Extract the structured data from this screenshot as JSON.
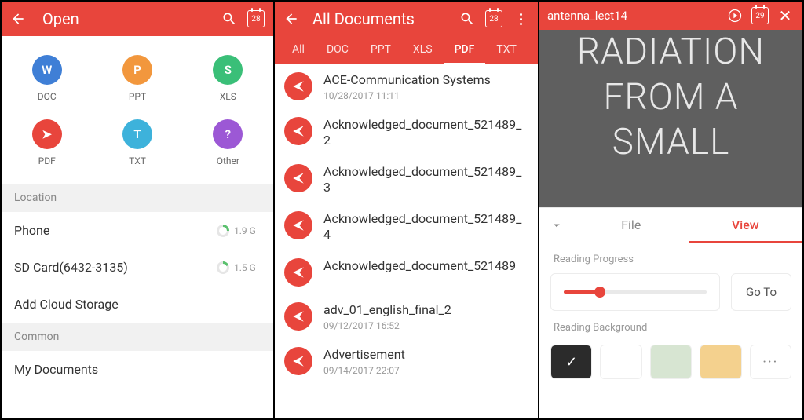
{
  "panel1": {
    "header": {
      "title": "Open",
      "calendar_day": "28"
    },
    "types": [
      {
        "label": "DOC",
        "glyph": "W",
        "css": "c-doc"
      },
      {
        "label": "PPT",
        "glyph": "P",
        "css": "c-ppt"
      },
      {
        "label": "XLS",
        "glyph": "S",
        "css": "c-xls"
      },
      {
        "label": "PDF",
        "glyph": "➤",
        "css": "c-pdf"
      },
      {
        "label": "TXT",
        "glyph": "T",
        "css": "c-txt"
      },
      {
        "label": "Other",
        "glyph": "?",
        "css": "c-other"
      }
    ],
    "location_label": "Location",
    "locations": [
      {
        "name": "Phone",
        "size": "1.9 G",
        "pct": 25
      },
      {
        "name": "SD Card(6432-3135)",
        "size": "1.5 G",
        "pct": 18
      }
    ],
    "add_cloud": "Add Cloud Storage",
    "common_label": "Common",
    "common_items": [
      {
        "name": "My Documents"
      }
    ]
  },
  "panel2": {
    "header": {
      "title": "All Documents",
      "calendar_day": "28"
    },
    "tabs": [
      "All",
      "DOC",
      "PPT",
      "XLS",
      "PDF",
      "TXT"
    ],
    "active_tab": 4,
    "docs": [
      {
        "title": "ACE-Communication Systems",
        "meta": "10/28/2017  11:11"
      },
      {
        "title": "Acknowledged_document_521489_2",
        "meta": ""
      },
      {
        "title": "Acknowledged_document_521489_3",
        "meta": ""
      },
      {
        "title": "Acknowledged_document_521489_4",
        "meta": ""
      },
      {
        "title": "Acknowledged_document_521489",
        "meta": ""
      },
      {
        "title": "adv_01_english_final_2",
        "meta": "09/12/2017  16:52"
      },
      {
        "title": "Advertisement",
        "meta": "09/14/2017  22:07"
      }
    ]
  },
  "panel3": {
    "header": {
      "title": "antenna_lect14",
      "calendar_day": "29"
    },
    "page_text": "RADIATION\nFROM A\nSMALL",
    "sheet": {
      "tabs": [
        "File",
        "View"
      ],
      "active": 1,
      "progress_label": "Reading Progress",
      "progress_pct": 25,
      "goto_label": "Go To",
      "bg_label": "Reading Background",
      "backgrounds": [
        {
          "color": "#2b2b2b",
          "selected": true
        },
        {
          "color": "#ffffff",
          "selected": false
        },
        {
          "color": "#d7e5d2",
          "selected": false
        },
        {
          "color": "#f4d18e",
          "selected": false
        }
      ],
      "more_glyph": "···"
    }
  }
}
